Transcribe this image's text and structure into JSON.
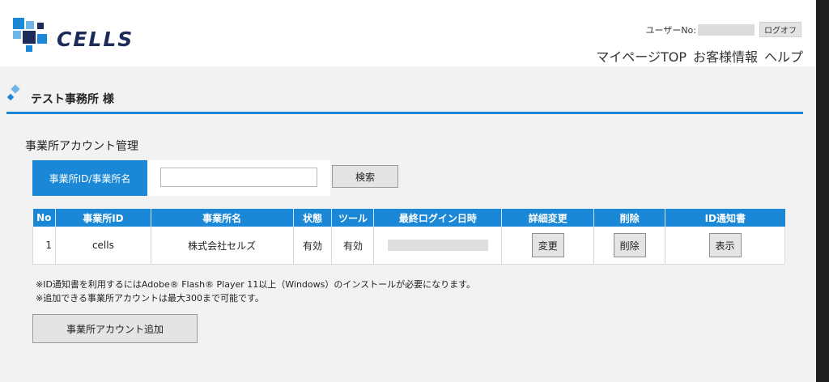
{
  "header": {
    "logo_text": "CELLS",
    "user_label": "ユーザーNo:",
    "logoff_label": "ログオフ",
    "nav": [
      "マイページTOP",
      "お客様情報",
      "ヘルプ"
    ]
  },
  "office": {
    "title": "テスト事務所 様"
  },
  "section": {
    "title": "事業所アカウント管理"
  },
  "search": {
    "label": "事業所ID/事業所名",
    "value": "",
    "button_label": "検索"
  },
  "table": {
    "headers": [
      "No",
      "事業所ID",
      "事業所名",
      "状態",
      "ツール",
      "最終ログイン日時",
      "詳細変更",
      "削除",
      "ID通知書"
    ],
    "rows": [
      {
        "no": "1",
        "office_id": "cells",
        "office_name": "株式会社セルズ",
        "status": "有効",
        "tool": "有効",
        "edit_label": "変更",
        "delete_label": "削除",
        "show_label": "表示"
      }
    ]
  },
  "notes": [
    "※ID通知書を利用するにはAdobe® Flash® Player 11以上（Windows）のインストールが必要になります。",
    "※追加できる事業所アカウントは最大300まで可能です。"
  ],
  "add_button_label": "事業所アカウント追加",
  "colors": {
    "accent": "#1a88d6",
    "logo_navy": "#1d2b5b",
    "logo_blue": "#1a88d6",
    "background": "#f2f2f2"
  }
}
